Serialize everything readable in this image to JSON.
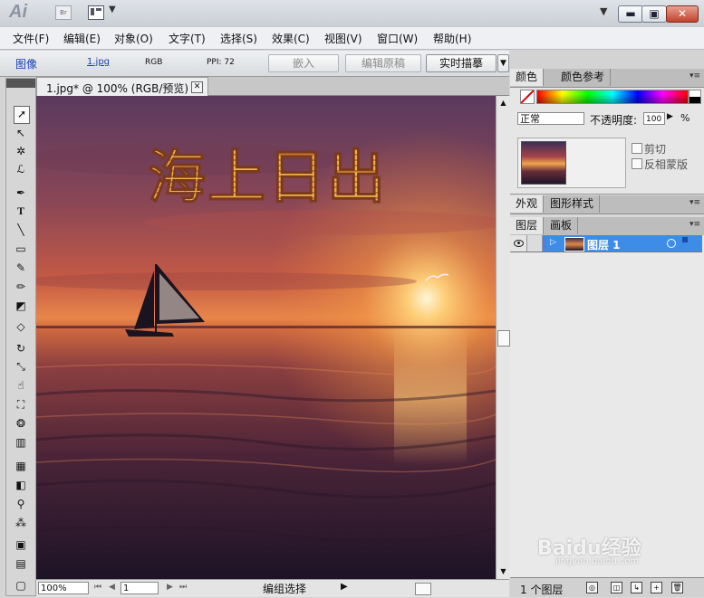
{
  "app": {
    "logo": "Ai",
    "bridge_button": "Br",
    "window_buttons": {
      "minimize": "▬",
      "maximize": "▣",
      "close": "✕"
    }
  },
  "menubar": {
    "items": [
      "文件(F)",
      "编辑(E)",
      "对象(O)",
      "文字(T)",
      "选择(S)",
      "效果(C)",
      "视图(V)",
      "窗口(W)",
      "帮助(H)"
    ]
  },
  "control_bar": {
    "object_type": "图像",
    "file_link": "1.jpg",
    "color_mode": "RGB",
    "ppi": "PPI: 72",
    "embed_button": "嵌入",
    "edit_original_button": "编辑原稿",
    "live_trace_button": "实时描摹"
  },
  "document": {
    "tab_title": "1.jpg* @ 100% (RGB/预览)",
    "canvas_heading": "海上日出",
    "zoom": "100%",
    "artboard": "1",
    "status_text": "编组选择"
  },
  "color_panel": {
    "tabs": [
      "颜色",
      "颜色参考"
    ]
  },
  "transparency_panel": {
    "blend_mode": "正常",
    "opacity_label": "不透明度:",
    "opacity_value": "100",
    "opacity_unit": "%",
    "clip_label": "剪切",
    "invert_mask_label": "反相蒙版"
  },
  "appearance_tabs": [
    "外观",
    "图形样式"
  ],
  "layers_panel": {
    "tabs": [
      "图层",
      "画板"
    ],
    "layer_name": "图层 1",
    "footer_count": "1 个图层"
  },
  "watermark": {
    "text": "Baidu经验",
    "sub": "jingyan.baidu.com"
  },
  "colors": {
    "layer_selection": "#3d8ce8",
    "heading_fill": "#f2b24a",
    "menu_link": "#1a3fb0"
  }
}
